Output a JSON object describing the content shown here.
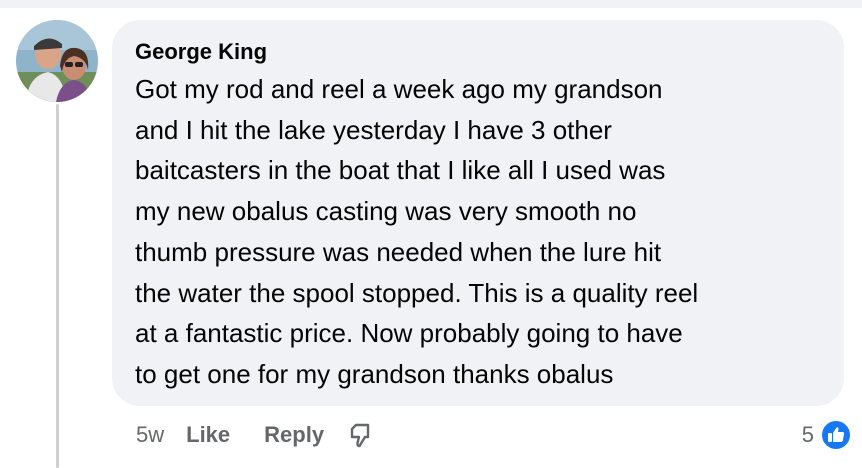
{
  "comment": {
    "author": "George King",
    "text_lines": [
      "Got my rod and reel a week ago my grandson",
      "and I hit the lake yesterday I have 3 other",
      "baitcasters in the boat that I like all I used was",
      "my new obalus casting was very smooth no",
      "thumb pressure was needed when the lure hit",
      "the water the spool stopped. This is a quality reel",
      "at a fantastic price. Now probably going to have",
      "to get one for my grandson thanks obalus"
    ],
    "timestamp": "5w",
    "reaction_count": "5"
  },
  "actions": {
    "like_label": "Like",
    "reply_label": "Reply"
  },
  "icons": {
    "dislike": "dislike-icon",
    "reaction": "like-reaction-icon"
  },
  "colors": {
    "bubble": "#f0f2f5",
    "text": "#050505",
    "secondary": "#65676b",
    "like_blue": "#1877f2"
  }
}
